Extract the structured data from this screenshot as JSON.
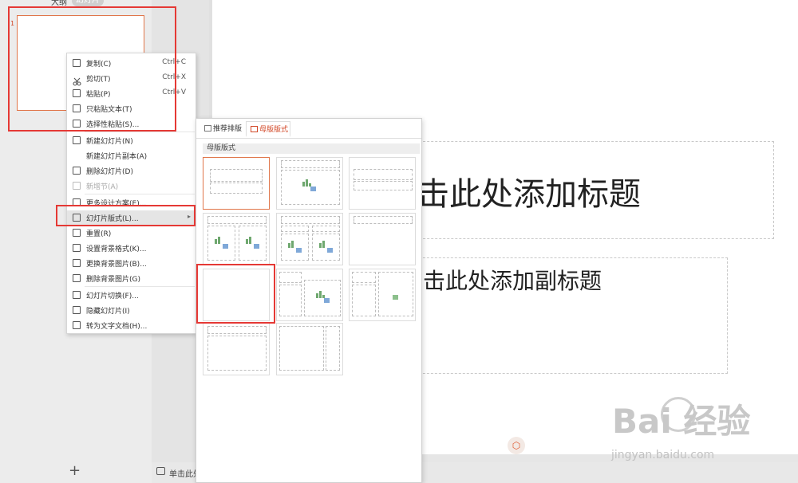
{
  "left_panel": {
    "tab_outline": "大纲",
    "tab_slides": "幻灯片",
    "slide_number": "1",
    "add_icon": "+"
  },
  "slide": {
    "title_placeholder": "击此处添加标题",
    "subtitle_placeholder": "击此处添加副标题"
  },
  "status": {
    "notes_text": "单击此处"
  },
  "context_menu": {
    "items": [
      {
        "label": "复制(C)",
        "shortcut": "Ctrl+C",
        "icon": "copy-icon"
      },
      {
        "label": "剪切(T)",
        "shortcut": "Ctrl+X",
        "icon": "scissors-icon"
      },
      {
        "label": "粘贴(P)",
        "shortcut": "Ctrl+V",
        "icon": "paste-icon"
      },
      {
        "label": "只粘贴文本(T)",
        "shortcut": "",
        "icon": "paste-text-icon"
      },
      {
        "label": "选择性粘贴(S)...",
        "shortcut": "",
        "icon": "paste-special-icon"
      },
      {
        "label": "新建幻灯片(N)",
        "shortcut": "",
        "icon": "new-slide-icon"
      },
      {
        "label": "新建幻灯片副本(A)",
        "shortcut": "",
        "icon": ""
      },
      {
        "label": "删除幻灯片(D)",
        "shortcut": "",
        "icon": "delete-slide-icon"
      },
      {
        "label": "新增节(A)",
        "shortcut": "",
        "icon": "section-icon"
      },
      {
        "label": "更多设计方案(E)...",
        "shortcut": "",
        "icon": "design-icon"
      },
      {
        "label": "幻灯片版式(L)...",
        "shortcut": "",
        "icon": "layout-icon"
      },
      {
        "label": "重置(R)",
        "shortcut": "",
        "icon": "reset-icon"
      },
      {
        "label": "设置背景格式(K)...",
        "shortcut": "",
        "icon": "background-format-icon"
      },
      {
        "label": "更换背景图片(B)...",
        "shortcut": "",
        "icon": "change-bg-image-icon"
      },
      {
        "label": "删除背景图片(G)",
        "shortcut": "",
        "icon": "delete-bg-image-icon"
      },
      {
        "label": "幻灯片切换(F)...",
        "shortcut": "",
        "icon": "transition-icon"
      },
      {
        "label": "隐藏幻灯片(I)",
        "shortcut": "",
        "icon": "hide-slide-icon"
      },
      {
        "label": "转为文字文档(H)...",
        "shortcut": "",
        "icon": "convert-doc-icon"
      }
    ]
  },
  "layout_popup": {
    "tab_recommended": "推荐排版",
    "tab_master": "母版版式",
    "section_label": "母版版式"
  },
  "watermark": {
    "brand": "Bai 经验",
    "url": "jingyan.baidu.com"
  },
  "colors": {
    "accent": "#d24726",
    "annotation_red": "#e53935",
    "selected_border": "#e0764a"
  }
}
